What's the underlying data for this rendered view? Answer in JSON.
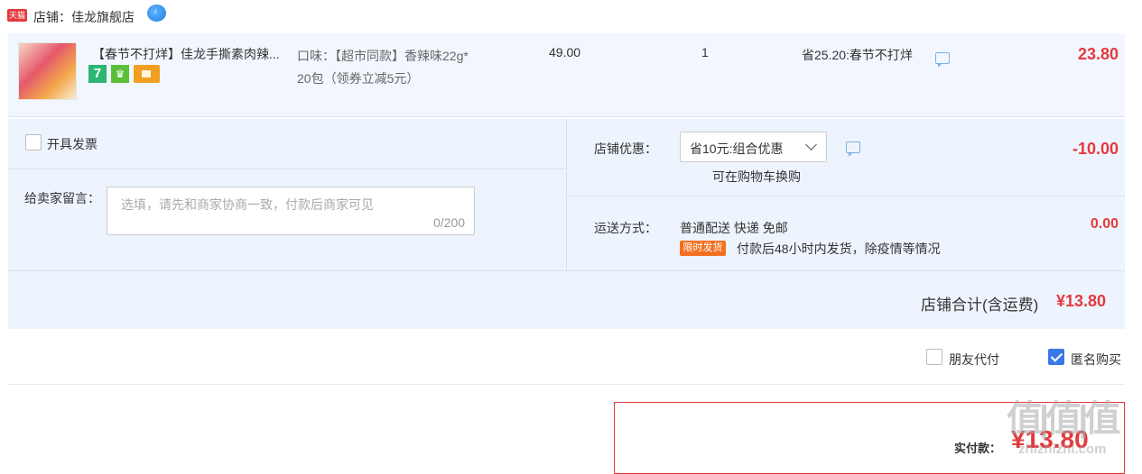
{
  "shop": {
    "tmall_badge": "天猫",
    "label": "店铺：佳龙旗舰店",
    "chat_icon_text": "♪"
  },
  "item": {
    "title": "【春节不打烊】佳龙手撕素肉辣...",
    "badge_7": "7",
    "badge_shield": "♛",
    "sku_line1": "口味：【超市同款】香辣味22g*",
    "sku_line2": "20包（领券立减5元）",
    "price": "49.00",
    "quantity": "1",
    "promotion": "省25.20:春节不打烊",
    "subtotal": "23.80"
  },
  "options": {
    "invoice_label": "开具发票",
    "note_label": "给卖家留言：",
    "note_placeholder": "选填，请先和商家协商一致，付款后商家可见",
    "note_count": "0/200",
    "shop_discount_label": "店铺优惠：",
    "shop_discount_value": "省10元:组合优惠",
    "shop_discount_hint": "可在购物车换购",
    "shop_discount_amount": "-10.00",
    "shipping_label": "运送方式：",
    "shipping_method": "普通配送 快递 免邮",
    "shipping_tag": "限时发货",
    "shipping_note": "付款后48小时内发货，除疫情等情况",
    "shipping_amount": "0.00"
  },
  "totals": {
    "shop_total_label": "店铺合计(含运费)",
    "shop_total_value": "¥13.80",
    "friend_pay_label": "朋友代付",
    "anonymous_label": "匿名购买",
    "paid_label": "实付款：",
    "paid_value": "¥13.80"
  },
  "watermark": {
    "logo": "值|值|值",
    "site": "zhizhizhi.com"
  },
  "colors": {
    "accent_red": "#e4393c",
    "row_bg": "#f2f7ff",
    "options_bg": "#eef4fd",
    "checkbox_blue": "#3b78e7"
  },
  "state": {
    "invoice_checked": false,
    "friend_pay_checked": false,
    "anonymous_checked": true
  }
}
